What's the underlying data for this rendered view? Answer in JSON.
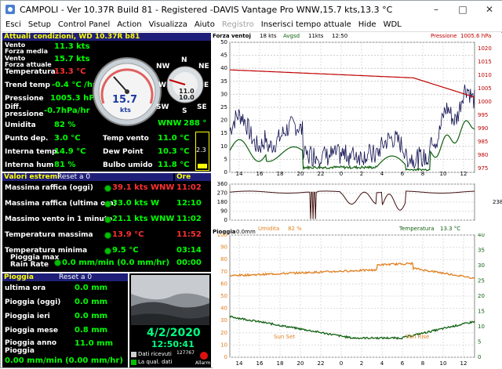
{
  "window": {
    "title": "CAMPOLI - Ver 10.37R Build 81 - Registered  -DAVIS Vantage Pro WNW,15.7 kts,13.3 °C",
    "min": "–",
    "max": "□",
    "close": "✕"
  },
  "menu": [
    {
      "label": "Esci",
      "enabled": true
    },
    {
      "label": "Setup",
      "enabled": true
    },
    {
      "label": "Control Panel",
      "enabled": true
    },
    {
      "label": "Action",
      "enabled": true
    },
    {
      "label": "Visualizza",
      "enabled": true
    },
    {
      "label": "Aiuto",
      "enabled": true
    },
    {
      "label": "Registro",
      "enabled": false
    },
    {
      "label": "Inserisci tempo attuale",
      "enabled": true
    },
    {
      "label": "Hide",
      "enabled": true
    },
    {
      "label": "WDL",
      "enabled": true
    }
  ],
  "current": {
    "header": "Attuali condizioni, WD 10.37R b81",
    "rows": [
      {
        "label": "Vento\nForza media",
        "value": "11.3 kts"
      },
      {
        "label": "Vento\nForza attuale",
        "value": "15.7 kts"
      },
      {
        "label": "Temperatura",
        "value": "13.3 °C"
      },
      {
        "label": "Trend temp",
        "value": "-0.4 °C /hr"
      },
      {
        "label": "Pressione",
        "value": "1005.3 hPa"
      },
      {
        "label": "Diff.\npressione",
        "value": "-0.7hPa/hr"
      },
      {
        "label": "Umidita",
        "value": "82 %"
      },
      {
        "label": "Punto dep.",
        "value": "3.0 °C"
      },
      {
        "label": "Interna temp.",
        "value": "14.9 °C"
      },
      {
        "label": "Interna hum",
        "value": "81 %"
      }
    ],
    "gauge": {
      "value": "15.7",
      "unit": "kts",
      "direction": "WNW",
      "dir_deg": "288 °",
      "compass": [
        "N",
        "NE",
        "E",
        "SE",
        "S",
        "SW",
        "W",
        "NW"
      ]
    },
    "mini_val": "11.0",
    "mini_sub": "10.0",
    "side_val": "2.3",
    "right_rows": [
      {
        "label": "Temp vento",
        "value": "11.0 °C"
      },
      {
        "label": "Dew Point",
        "value": "10.3 °C"
      },
      {
        "label": "Bulbo umido",
        "value": "11.8 °C"
      }
    ]
  },
  "extremes": {
    "header": "Valori estremi",
    "reset": "Reset a 0",
    "hours_header": "Ore",
    "rows": [
      {
        "label": "Massima raffica (oggi)",
        "value": "39.1 kts WNW",
        "time": "11:02",
        "red": true
      },
      {
        "label": "Massima raffica (ultima ora)",
        "value": "33.0 kts   W",
        "time": "12:10",
        "red": false
      },
      {
        "label": "Massimo vento in 1 minuto",
        "value": "21.1 kts WNW",
        "time": "11:02",
        "red": false
      },
      {
        "label": "Temperatura massima",
        "value": "13.9 °C",
        "time": "11:52",
        "red": true
      },
      {
        "label": "Temperatura minima",
        "value": "9.5 °C",
        "time": "03:14",
        "red": false
      },
      {
        "label": "Pioggia max\nRain Rate",
        "value": "0.0 mm/min (0.0 mm/hr)",
        "time": "00:00",
        "red": false
      }
    ]
  },
  "rain": {
    "header": "Pioggia",
    "reset": "Reset a 0",
    "rows": [
      {
        "label": "ultima ora",
        "value": "0.0 mm"
      },
      {
        "label": "Pioggia (oggi)",
        "value": "0.0 mm"
      },
      {
        "label": "Pioggia ieri",
        "value": "0.0 mm"
      },
      {
        "label": "Pioggia mese",
        "value": "0.8 mm"
      },
      {
        "label": "Pioggia anno\nPioggia",
        "value": "11.0 mm"
      }
    ],
    "rate": "0.00 mm/min (0.00 mm/hr)"
  },
  "clock": {
    "date": "4/2/2020",
    "time": "12:50:41",
    "left_val": "0,0",
    "count": "127767",
    "legend1": "Dati ricevuti",
    "legend2": "La qual. dati",
    "alarm": "Allarm"
  },
  "graph1": {
    "legend_left": "Forza ventoj",
    "l1": "18 kts",
    "l2": "Avgsd",
    "l3": "11kts",
    "l4": "12:50",
    "legend_right": "Pressione",
    "right_val": "1005.6 hPa",
    "left_axis": [
      "50",
      "45",
      "40",
      "35",
      "30",
      "25",
      "20",
      "15",
      "10",
      "5",
      "0"
    ],
    "right_axis": [
      "1020",
      "1015",
      "1010",
      "1005",
      "1000",
      "995",
      "990",
      "985",
      "980",
      "975"
    ]
  },
  "graph2": {
    "left_axis": [
      "360",
      "270",
      "180",
      "90",
      "0"
    ],
    "right": "238°",
    "leg_left": "Umidita",
    "leg_left_val": "82 %",
    "leg_right": "Temperatura",
    "leg_right_val": "13.3 °C"
  },
  "graph3": {
    "legend_left": "Pioggia",
    "legend_val": "0.0mm",
    "left_axis": [
      "100",
      "90",
      "80",
      "70",
      "60",
      "50",
      "40",
      "30",
      "20",
      "10",
      "0"
    ],
    "right_axis": [
      "40",
      "35",
      "30",
      "25",
      "20",
      "15",
      "10",
      "5",
      "0"
    ],
    "sunset": "Sun Set",
    "sunrise": "Sun Rise"
  },
  "time_axis": [
    "14",
    "16",
    "18",
    "20",
    "22",
    "0",
    "2",
    "4",
    "6",
    "8",
    "10",
    "12"
  ],
  "colors": {
    "panel_bg": "#000000",
    "label": "#ffffff",
    "value": "#00ff00",
    "alert": "#ff3030",
    "header": "#ffff00",
    "wind": "#101050",
    "gust_avg": "#106010",
    "pressure": "#c00000",
    "humidity": "#e08020",
    "temp": "#106010",
    "direction": "#401010"
  }
}
